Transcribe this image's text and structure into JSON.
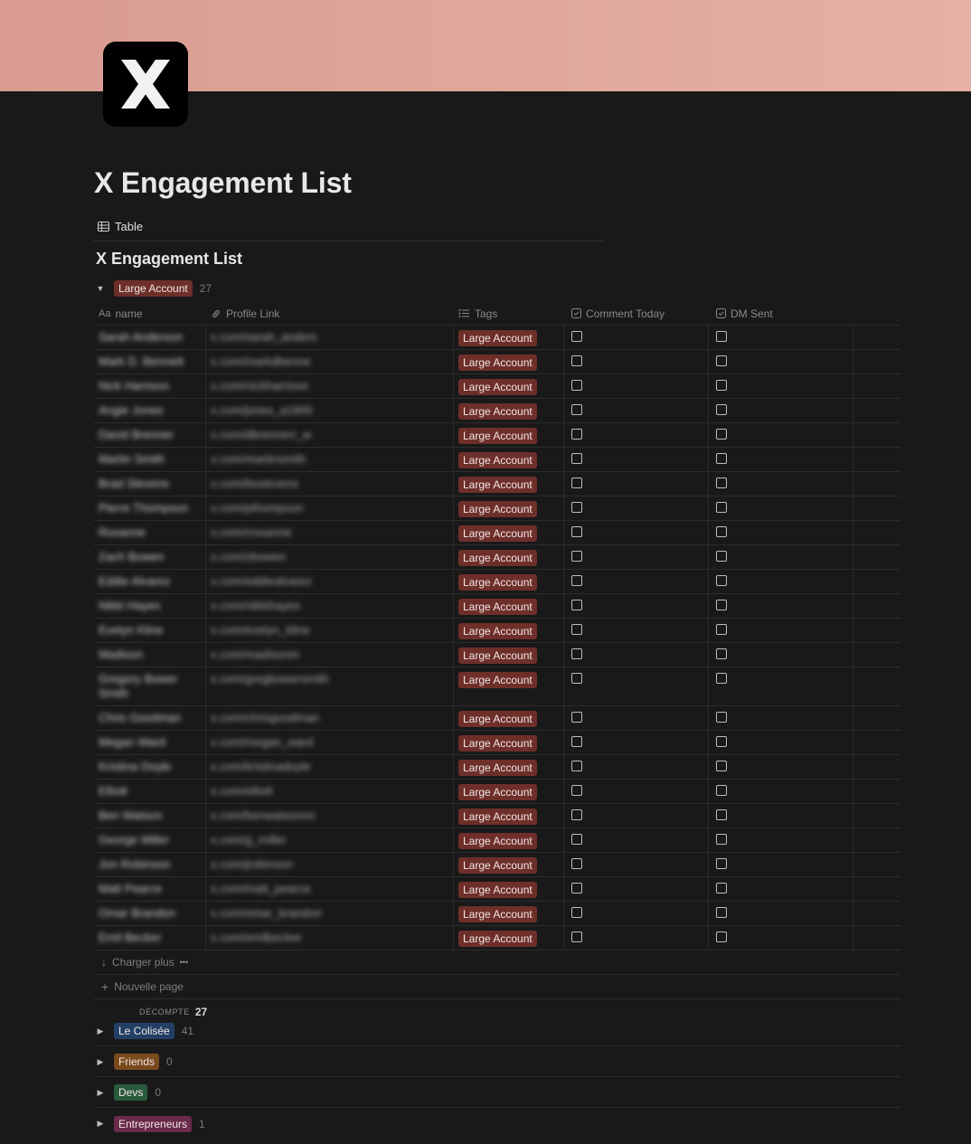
{
  "page": {
    "title": "X Engagement List",
    "icon_letter": "X",
    "view_tab": "Table",
    "database_title": "X Engagement List"
  },
  "colors": {
    "background": "#191919",
    "large_account": "#6e2f2a",
    "le_colisee": "#233f66",
    "friends": "#7a4a1d",
    "devs": "#2a5a3c",
    "entrepreneurs": "#6a2a4a"
  },
  "columns": {
    "name": {
      "prefix": "Aa",
      "label": "name"
    },
    "profile_link": {
      "icon": "link-icon",
      "label": "Profile Link"
    },
    "tags": {
      "icon": "list-icon",
      "label": "Tags"
    },
    "comment_today": {
      "icon": "checkbox-icon",
      "label": "Comment Today"
    },
    "dm_sent": {
      "icon": "checkbox-icon",
      "label": "DM Sent"
    }
  },
  "groups": [
    {
      "label": "Large Account",
      "count": "27",
      "expanded": true
    },
    {
      "label": "Le Colisée",
      "count": "41",
      "expanded": false
    },
    {
      "label": "Friends",
      "count": "0",
      "expanded": false
    },
    {
      "label": "Devs",
      "count": "0",
      "expanded": false
    },
    {
      "label": "Entrepreneurs",
      "count": "1",
      "expanded": false
    }
  ],
  "rows": [
    {
      "name": "Sarah Anderson",
      "link": "x.com/sarah_anders",
      "tag": "Large Account",
      "comment_today": false,
      "dm_sent": false
    },
    {
      "name": "Mark D. Bennett",
      "link": "x.com/markdbenne",
      "tag": "Large Account",
      "comment_today": false,
      "dm_sent": false
    },
    {
      "name": "Nick Harrison",
      "link": "x.com/nickharrison",
      "tag": "Large Account",
      "comment_today": false,
      "dm_sent": false
    },
    {
      "name": "Angie Jones",
      "link": "x.com/jones_a1900",
      "tag": "Large Account",
      "comment_today": false,
      "dm_sent": false
    },
    {
      "name": "David Brenner",
      "link": "x.com/dbrennerr_w",
      "tag": "Large Account",
      "comment_today": false,
      "dm_sent": false
    },
    {
      "name": "Martin Smith",
      "link": "x.com/martinsmith",
      "tag": "Large Account",
      "comment_today": false,
      "dm_sent": false
    },
    {
      "name": "Brad Stevens",
      "link": "x.com/bsstevens",
      "tag": "Large Account",
      "comment_today": false,
      "dm_sent": false
    },
    {
      "name": "Pierre Thompson",
      "link": "x.com/pthompson",
      "tag": "Large Account",
      "comment_today": false,
      "dm_sent": false
    },
    {
      "name": "Roxanne",
      "link": "x.com/rroxanne",
      "tag": "Large Account",
      "comment_today": false,
      "dm_sent": false
    },
    {
      "name": "Zach Bowen",
      "link": "x.com/zbowen",
      "tag": "Large Account",
      "comment_today": false,
      "dm_sent": false
    },
    {
      "name": "Eddie Alvarez",
      "link": "x.com/eddiealvarez",
      "tag": "Large Account",
      "comment_today": false,
      "dm_sent": false
    },
    {
      "name": "Nikki Hayes",
      "link": "x.com/nikkihayes",
      "tag": "Large Account",
      "comment_today": false,
      "dm_sent": false
    },
    {
      "name": "Evelyn Kline",
      "link": "x.com/evelyn_kline",
      "tag": "Large Account",
      "comment_today": false,
      "dm_sent": false
    },
    {
      "name": "Madison",
      "link": "x.com/madisonm",
      "tag": "Large Account",
      "comment_today": false,
      "dm_sent": false
    },
    {
      "name": "Gregory Bower Smith",
      "link": "x.com/gregbowersmith",
      "tag": "Large Account",
      "comment_today": false,
      "dm_sent": false
    },
    {
      "name": "Chris Goodman",
      "link": "x.com/chrisgoodman",
      "tag": "Large Account",
      "comment_today": false,
      "dm_sent": false
    },
    {
      "name": "Megan Ward",
      "link": "x.com/megan_ward",
      "tag": "Large Account",
      "comment_today": false,
      "dm_sent": false
    },
    {
      "name": "Kristina Doyle",
      "link": "x.com/kristinadoyle",
      "tag": "Large Account",
      "comment_today": false,
      "dm_sent": false
    },
    {
      "name": "Elliott",
      "link": "x.com/elliott",
      "tag": "Large Account",
      "comment_today": false,
      "dm_sent": false
    },
    {
      "name": "Ben Watson",
      "link": "x.com/benwatsonnn",
      "tag": "Large Account",
      "comment_today": false,
      "dm_sent": false
    },
    {
      "name": "George Miller",
      "link": "x.com/g_miller",
      "tag": "Large Account",
      "comment_today": false,
      "dm_sent": false
    },
    {
      "name": "Jon Robinson",
      "link": "x.com/jrobinson",
      "tag": "Large Account",
      "comment_today": false,
      "dm_sent": false
    },
    {
      "name": "Matt Pearce",
      "link": "x.com/matt_pearce",
      "tag": "Large Account",
      "comment_today": false,
      "dm_sent": false
    },
    {
      "name": "Omar Brandon",
      "link": "x.com/omar_brandon",
      "tag": "Large Account",
      "comment_today": false,
      "dm_sent": false
    },
    {
      "name": "Emil Becker",
      "link": "x.com/emilbecker",
      "tag": "Large Account",
      "comment_today": false,
      "dm_sent": false
    }
  ],
  "footer": {
    "load_more": "Charger plus",
    "more_dots": "•••",
    "new_page": "Nouvelle page",
    "calc_label": "DÉCOMPTE",
    "calc_value": "27"
  }
}
